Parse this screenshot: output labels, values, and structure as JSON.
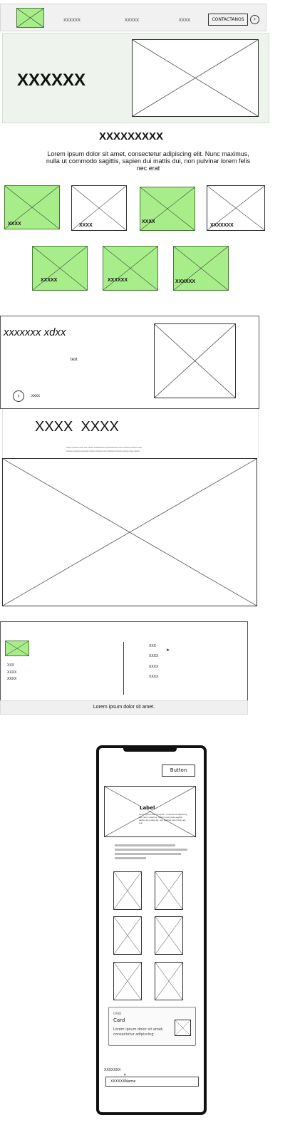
{
  "header": {
    "nav": [
      "XXXXXX",
      "XXXXX",
      "XXXX"
    ],
    "cta_label": "CONTACTANOS",
    "cta_icon": "chevron-right-circle-icon"
  },
  "hero": {
    "title": "XXXXXX"
  },
  "intro": {
    "title": "XXXXXXXXX",
    "text": "Lorem ipsum dolor sit amet, consectetur adipiscing elit. Nunc maximus, nulla ut commodo sagittis, sapien dui mattis dui, non pulvinar lorem felis nec erat"
  },
  "tiles_row1": [
    "XXXX",
    "XXXX",
    "XXXX",
    "XXXXXXX"
  ],
  "tiles_row2": [
    "XXXXX",
    "XXXXXX",
    "XXXXXX"
  ],
  "feature": {
    "title": "xxxxxxx xdxx",
    "text": "text",
    "link": "xxxx"
  },
  "media": {
    "title": "XXXX  XXXX",
    "caption_line1": "xxxxx xxxxxx xxxx xxx xxxxx xxxxxxxxxxx xxxxxxxxxxx xxxx xxxxxx xxxxxx xxxx",
    "caption_line2": "xxxxxx xxxxxxx xxxxxxx xxxxx xxxxxxx xxx xxxxxxx xxxxxx xxxxxx xxxx xxxxx"
  },
  "footer": {
    "left_links": [
      "XXX",
      "XXXX",
      "XXXX"
    ],
    "right_links": [
      "XXX",
      "XXXX",
      "XXXX",
      "XXXX"
    ],
    "copyright": "Lorem ipsum dolor sit amet."
  },
  "phone": {
    "button_label": "Button",
    "image_label": "Label",
    "image_text": "Lorem ipsum dolor sit amet, consectetur adipiscing elit. Nunc maximus, nulla ut commodo sagittis, sapien dui mattis dui, non pulvinar lorem felis nec erat",
    "card_caption": "CARD",
    "card_title": "Card",
    "card_text": "Lorem ipsum dolor sit amet, consectetur adipiscing",
    "field_label": "XXXXXXX",
    "field_value": "XXXXXXName"
  },
  "colors": {
    "accent_green": "#a7ee8a",
    "hero_bg": "#eef4ed",
    "footer_bar": "#f0f0f0"
  }
}
